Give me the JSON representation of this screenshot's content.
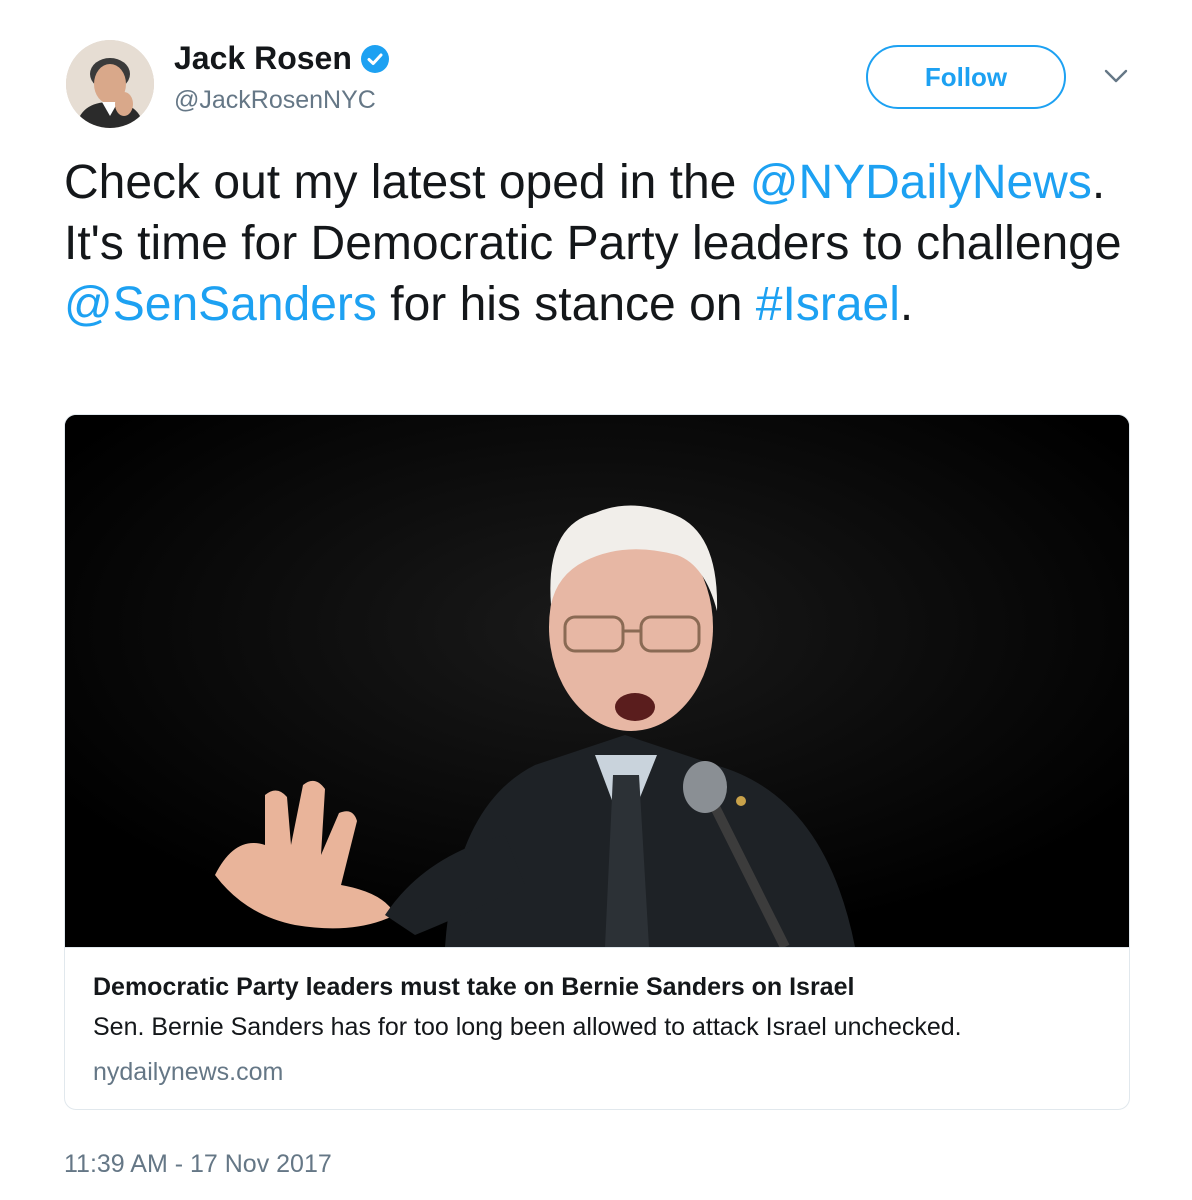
{
  "colors": {
    "accent": "#1da1f2",
    "text": "#14171a",
    "secondary_text": "#657786",
    "border": "#e1e8ed",
    "card_image_background": "#000000"
  },
  "author": {
    "name": "Jack Rosen",
    "handle": "@JackRosenNYC",
    "verified": true,
    "avatar_icon": "profile-photo",
    "verified_icon": "verified-badge-icon"
  },
  "actions": {
    "follow_label": "Follow",
    "menu_icon": "chevron-down-icon"
  },
  "tweet": {
    "segments": [
      {
        "text": "Check out my latest oped in the ",
        "type": "text"
      },
      {
        "text": "@NYDailyNews",
        "type": "mention"
      },
      {
        "text": ". It's time for Democratic Party leaders to challenge ",
        "type": "text"
      },
      {
        "text": "@SenSanders",
        "type": "mention"
      },
      {
        "text": " for his stance on ",
        "type": "text"
      },
      {
        "text": "#Israel",
        "type": "hashtag"
      },
      {
        "text": ".",
        "type": "text"
      }
    ]
  },
  "card": {
    "image_description_icon": "article-photo",
    "title": "Democratic Party leaders must take on Bernie Sanders on Israel",
    "description": "Sen. Bernie Sanders has for too long been allowed to attack Israel unchecked.",
    "domain": "nydailynews.com"
  },
  "timestamp": "11:39 AM - 17 Nov 2017"
}
